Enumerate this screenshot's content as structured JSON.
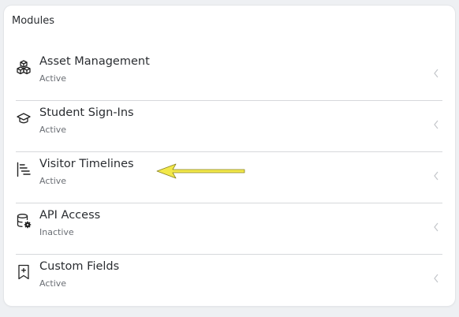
{
  "card": {
    "title": "Modules"
  },
  "modules": [
    {
      "name": "Asset Management",
      "status": "Active",
      "icon": "cubes-icon"
    },
    {
      "name": "Student Sign-Ins",
      "status": "Active",
      "icon": "graduation-cap-icon"
    },
    {
      "name": "Visitor Timelines",
      "status": "Active",
      "icon": "timeline-icon"
    },
    {
      "name": "API Access",
      "status": "Inactive",
      "icon": "database-gear-icon"
    },
    {
      "name": "Custom Fields",
      "status": "Active",
      "icon": "bookmark-plus-icon"
    }
  ],
  "annotation": {
    "arrow_color": "#f2e84a",
    "points_to": "Visitor Timelines"
  }
}
